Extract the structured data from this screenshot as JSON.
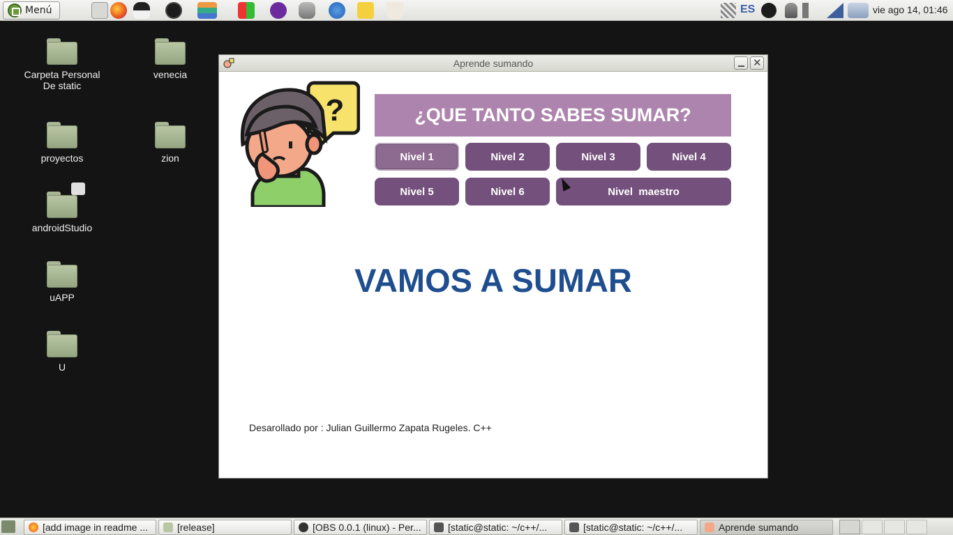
{
  "top_panel": {
    "menu_label": "Menú",
    "language": "ES",
    "clock": "vie ago 14, 01:46",
    "launchers": [
      "file-manager-icon",
      "firefox-icon",
      "tux-icon",
      "obs-icon",
      "books-icon",
      "office-icon",
      "tor-icon",
      "database-icon",
      "thunderbird-icon",
      "notes-icon",
      "java-icon"
    ]
  },
  "desktop": {
    "icons": [
      {
        "label_line1": "Carpeta Personal",
        "label_line2": "De static"
      },
      {
        "label_line1": "venecia"
      },
      {
        "label_line1": "proyectos"
      },
      {
        "label_line1": "zion"
      },
      {
        "label_line1": "androidStudio"
      },
      {
        "label_line1": "uAPP"
      },
      {
        "label_line1": "U"
      }
    ]
  },
  "window": {
    "title": "Aprende sumando",
    "banner": "¿QUE TANTO SABES SUMAR?",
    "levels": [
      "Nivel 1",
      "Nivel 2",
      "Nivel 3",
      "Nivel 4",
      "Nivel 5",
      "Nivel 6",
      "Nivel  maestro"
    ],
    "heading": "VAMOS A SUMAR",
    "credit": "Desarollado por : Julian Guillermo Zapata Rugeles. C++"
  },
  "taskbar": {
    "tasks": [
      {
        "label": "[add image in readme ...",
        "icon": "firefox-icon"
      },
      {
        "label": "[release]",
        "icon": "folder-icon"
      },
      {
        "label": "[OBS 0.0.1 (linux) - Per...",
        "icon": "obs-icon"
      },
      {
        "label": "[static@static: ~/c++/...",
        "icon": "terminal-icon"
      },
      {
        "label": "[static@static: ~/c++/...",
        "icon": "terminal-icon"
      },
      {
        "label": "Aprende sumando",
        "icon": "app-icon"
      }
    ]
  },
  "colors": {
    "banner": "#ad84ad",
    "level_button": "#74517c",
    "heading": "#1f4e8f"
  }
}
